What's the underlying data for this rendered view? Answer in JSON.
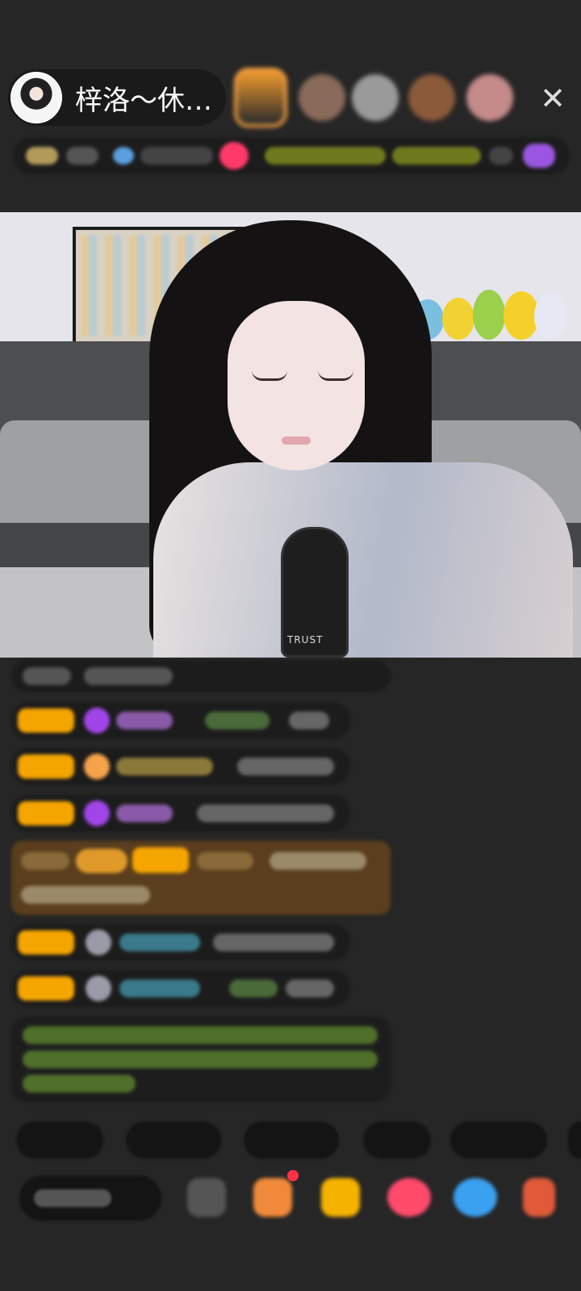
{
  "header": {
    "host_name": "梓洛～休…",
    "close_icon": "close-icon",
    "viewer_count": 5
  },
  "video": {
    "mic_brand": "TRUST"
  },
  "chat": {
    "message_count": 9,
    "highlighted_message_index": 4,
    "system_message_index": 8
  },
  "quick_replies": {
    "count": 6
  },
  "toolbar": {
    "tools": [
      "emoji-icon",
      "gift-box-icon",
      "treasure-icon",
      "heart-icon",
      "game-icon",
      "more-icon"
    ]
  },
  "colors": {
    "background": "#262626",
    "badge": "#f5a500",
    "highlight": "#5a3e1d",
    "system_text": "#8bc34a",
    "notification": "#ff3048"
  }
}
